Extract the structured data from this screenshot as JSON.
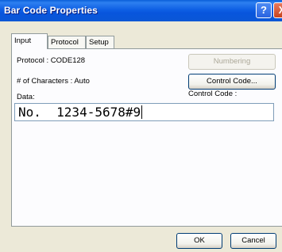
{
  "window": {
    "title": "Bar Code Properties"
  },
  "titlebar_buttons": {
    "help": "?",
    "close": "X"
  },
  "tabs": [
    {
      "label": "Input",
      "active": true
    },
    {
      "label": "Protocol",
      "active": false
    },
    {
      "label": "Setup",
      "active": false
    }
  ],
  "input_tab": {
    "protocol_label": "Protocol : CODE128",
    "characters_label": "# of Characters : Auto",
    "numbering_button": "Numbering",
    "control_code_button": "Control Code...",
    "control_code_label": "Control Code :",
    "data_label": "Data:",
    "data_value": "No.  1234-5678#9"
  },
  "footer": {
    "ok_label": "OK",
    "cancel_label": "Cancel"
  }
}
